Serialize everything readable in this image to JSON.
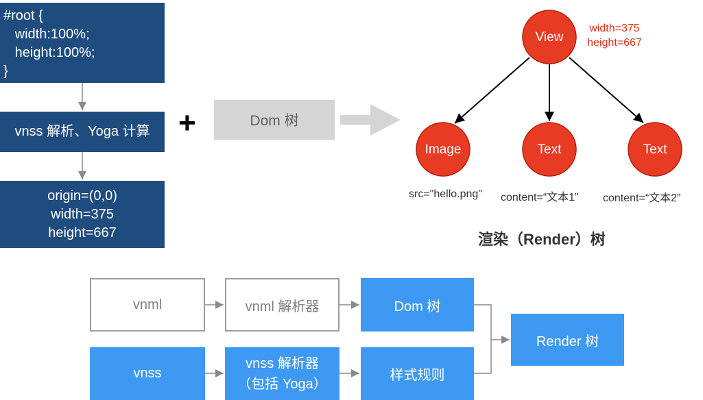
{
  "left_column": {
    "css_box": "#root {\n   width:100%;\n   height:100%;\n}",
    "parse_box": "vnss 解析、Yoga 计算",
    "result_box": "origin=(0,0)\nwidth=375\nheight=667"
  },
  "plus": "+",
  "dom_box": "Dom 树",
  "render_tree": {
    "nodes": {
      "view": "View",
      "image": "Image",
      "text1": "Text",
      "text2": "Text"
    },
    "view_size": "width=375\nheight=667",
    "captions": {
      "image": "src=\"hello.png\"",
      "text1": "content=“文本1”",
      "text2": "content=“文本2”"
    },
    "title": "渲染（Render）树"
  },
  "pipeline": {
    "vnml": "vnml",
    "vnml_parser": "vnml 解析器",
    "dom": "Dom 树",
    "vnss": "vnss",
    "vnss_parser": "vnss 解析器\n（包括 Yoga）",
    "style_rules": "样式规则",
    "render": "Render 树"
  },
  "colors": {
    "navy": "#1f4c7e",
    "blue": "#3d99f2",
    "node_red": "#e83b24",
    "gray_arrow": "#d5d5d5",
    "outline_gray": "#9c9c9c"
  }
}
